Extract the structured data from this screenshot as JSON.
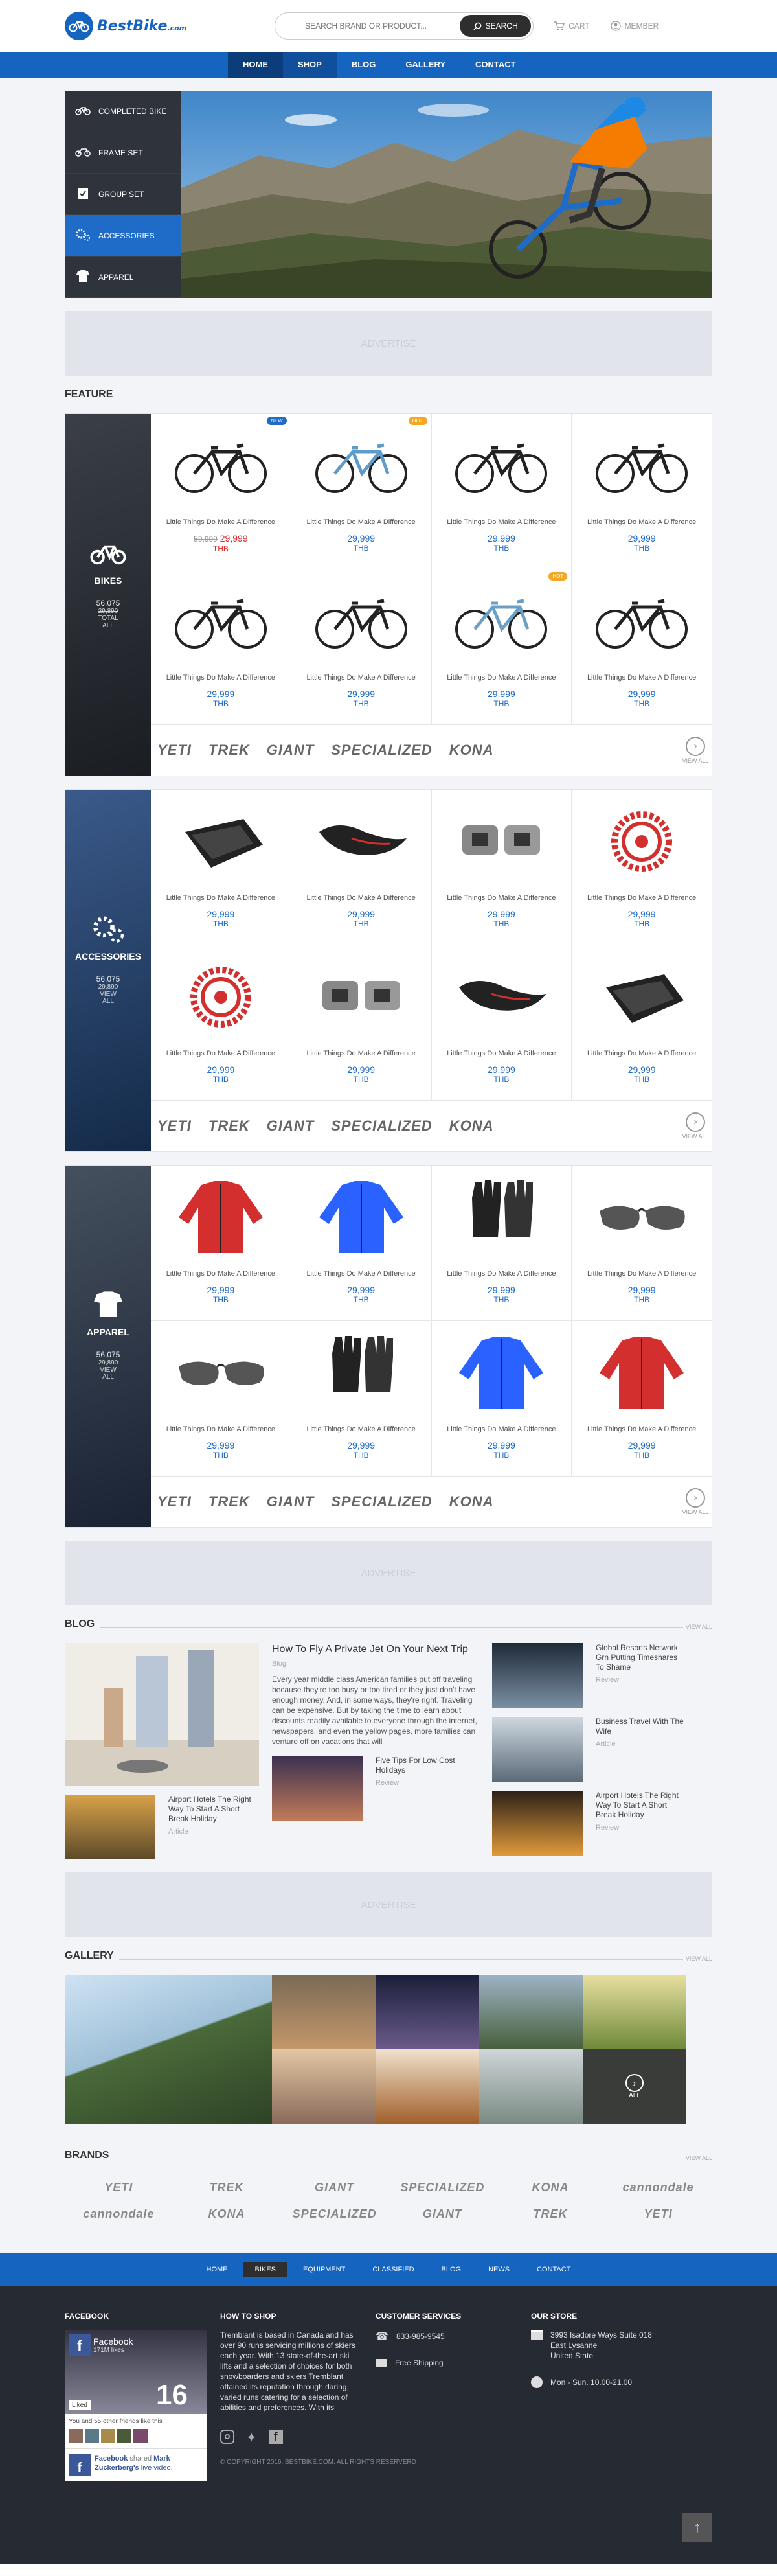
{
  "brand": {
    "name": "BestBike",
    "suffix": ".com"
  },
  "header": {
    "search_placeholder": "SEARCH BRAND OR PRODUCT...",
    "search_button": "SEARCH",
    "cart": "CART",
    "member": "MEMBER"
  },
  "nav": [
    "HOME",
    "SHOP",
    "BLOG",
    "GALLERY",
    "CONTACT"
  ],
  "categories": [
    {
      "label": "COMPLETED BIKE",
      "icon": "bike-icon"
    },
    {
      "label": "FRAME SET",
      "icon": "frame-icon"
    },
    {
      "label": "GROUP SET",
      "icon": "box-check-icon"
    },
    {
      "label": "ACCESSORIES",
      "icon": "gears-icon"
    },
    {
      "label": "APPAREL",
      "icon": "shirt-icon"
    }
  ],
  "advertise": "ADVERTISE",
  "feature_title": "FEATURE",
  "blocks": [
    {
      "label": "BIKES",
      "count": "56,075",
      "old": "29,890",
      "small1": "TOTAL",
      "small2": "ALL",
      "products": [
        {
          "name": "Little Things Do Make A Difference",
          "price": "29,999",
          "old": "59,999",
          "sale": true,
          "cur": "THB",
          "badge": "NEW",
          "badge_color": "#1e6cc8"
        },
        {
          "name": "Little Things Do Make A Difference",
          "price": "29,999",
          "cur": "THB",
          "badge": "HOT",
          "badge_color": "#f5a623"
        },
        {
          "name": "Little Things Do Make A Difference",
          "price": "29,999",
          "cur": "THB"
        },
        {
          "name": "Little Things Do Make A Difference",
          "price": "29,999",
          "cur": "THB"
        },
        {
          "name": "Little Things Do Make A Difference",
          "price": "29,999",
          "cur": "THB"
        },
        {
          "name": "Little Things Do Make A Difference",
          "price": "29,999",
          "cur": "THB"
        },
        {
          "name": "Little Things Do Make A Difference",
          "price": "29,999",
          "cur": "THB",
          "badge": "HOT",
          "badge_color": "#f5a623"
        },
        {
          "name": "Little Things Do Make A Difference",
          "price": "29,999",
          "cur": "THB"
        }
      ]
    },
    {
      "label": "ACCESSORIES",
      "count": "56,075",
      "old": "29,890",
      "small1": "VIEW",
      "small2": "ALL",
      "products": [
        {
          "name": "Little Things Do Make A Difference",
          "price": "29,999",
          "cur": "THB"
        },
        {
          "name": "Little Things Do Make A Difference",
          "price": "29,999",
          "cur": "THB"
        },
        {
          "name": "Little Things Do Make A Difference",
          "price": "29,999",
          "cur": "THB"
        },
        {
          "name": "Little Things Do Make A Difference",
          "price": "29,999",
          "cur": "THB"
        },
        {
          "name": "Little Things Do Make A Difference",
          "price": "29,999",
          "cur": "THB"
        },
        {
          "name": "Little Things Do Make A Difference",
          "price": "29,999",
          "cur": "THB"
        },
        {
          "name": "Little Things Do Make A Difference",
          "price": "29,999",
          "cur": "THB"
        },
        {
          "name": "Little Things Do Make A Difference",
          "price": "29,999",
          "cur": "THB"
        }
      ]
    },
    {
      "label": "APPAREL",
      "count": "56,075",
      "old": "29,890",
      "small1": "VIEW",
      "small2": "ALL",
      "products": [
        {
          "name": "Little Things Do Make A Difference",
          "price": "29,999",
          "cur": "THB"
        },
        {
          "name": "Little Things Do Make A Difference",
          "price": "29,999",
          "cur": "THB"
        },
        {
          "name": "Little Things Do Make A Difference",
          "price": "29,999",
          "cur": "THB"
        },
        {
          "name": "Little Things Do Make A Difference",
          "price": "29,999",
          "cur": "THB"
        },
        {
          "name": "Little Things Do Make A Difference",
          "price": "29,999",
          "cur": "THB"
        },
        {
          "name": "Little Things Do Make A Difference",
          "price": "29,999",
          "cur": "THB"
        },
        {
          "name": "Little Things Do Make A Difference",
          "price": "29,999",
          "cur": "THB"
        },
        {
          "name": "Little Things Do Make A Difference",
          "price": "29,999",
          "cur": "THB"
        }
      ]
    }
  ],
  "brand_logos": [
    "YETI",
    "TREK",
    "GIANT",
    "SPECIALIZED",
    "KONA"
  ],
  "view_all": "VIEW ALL",
  "blog": {
    "title": "BLOG",
    "view_all": "VIEW ALL",
    "main": {
      "title": "How To Fly A Private Jet On Your Next Trip",
      "cat": "Blog",
      "body": "Every year middle class American families put off traveling because they're too busy or too tired or they just don't have enough money. And, in some ways, they're right. Traveling can be expensive. But by taking the time to learn about discounts readily available to everyone through the internet, newspapers, and even the yellow pages, more families can venture off on vacations that will"
    },
    "small": [
      {
        "title": "Airport Hotels The Right Way To Start A Short Break Holiday",
        "cat": "Article"
      },
      {
        "title": "Five Tips For Low Cost Holidays",
        "cat": "Review"
      },
      {
        "title": "Global Resorts Network Grn Putting Timeshares To Shame",
        "cat": "Review"
      },
      {
        "title": "Business Travel With The Wife",
        "cat": "Article"
      },
      {
        "title": "Airport Hotels The Right Way To Start A Short Break Holiday",
        "cat": "Review"
      }
    ]
  },
  "gallery_title": "GALLERY",
  "gallery_view_all": "VIEW ALL",
  "gallery_more": "ALL",
  "brands_title": "BRANDS",
  "brands_view_all": "VIEW ALL",
  "brands_row1": [
    "YETI",
    "TREK",
    "GIANT",
    "SPECIALIZED",
    "KONA",
    "cannondale"
  ],
  "brands_row2": [
    "cannondale",
    "KONA",
    "SPECIALIZED",
    "GIANT",
    "TREK",
    "YETI"
  ],
  "footer_nav": [
    "HOME",
    "BIKES",
    "EQUIPMENT",
    "CLASSIFIED",
    "BLOG",
    "NEWS",
    "CONTACT"
  ],
  "footer": {
    "facebook_title": "FACEBOOK",
    "fb_page": "Facebook",
    "fb_likes": "171M likes",
    "fb_liked": "Liked",
    "fb_friends": "You and 55 other friends like this",
    "fb_post_name": "Facebook",
    "fb_post_text": "shared",
    "fb_post_name2": "Mark Zuckerberg's",
    "fb_post_text2": "live video.",
    "fb_jersey": "16",
    "howto_title": "HOW TO SHOP",
    "howto_text": "Tremblant is based in Canada and has over 90 runs servicing millions of skiers each year. With 13 state-of-the-art ski lifts and a selection of choices for both snowboarders and skiers Tremblant attained its reputation through daring, varied runs catering for a selection of abilities and preferences. With its",
    "service_title": "CUSTOMER SERVICES",
    "phone": "833-985-9545",
    "shipping": "Free Shipping",
    "store_title": "OUR STORE",
    "address1": "3993 Isadore Ways Suite 018",
    "address2": "East Lysanne",
    "address3": "United State",
    "hours": "Mon - Sun. 10.00-21.00",
    "copyright": "© COPYRIGHT 2016. BESTBIKE.COM. ALL RIGHTS RESERVERD"
  },
  "colors": {
    "brand_blue": "#1565c0",
    "footer_dark": "#262a33",
    "sale_red": "#d32f2f"
  }
}
